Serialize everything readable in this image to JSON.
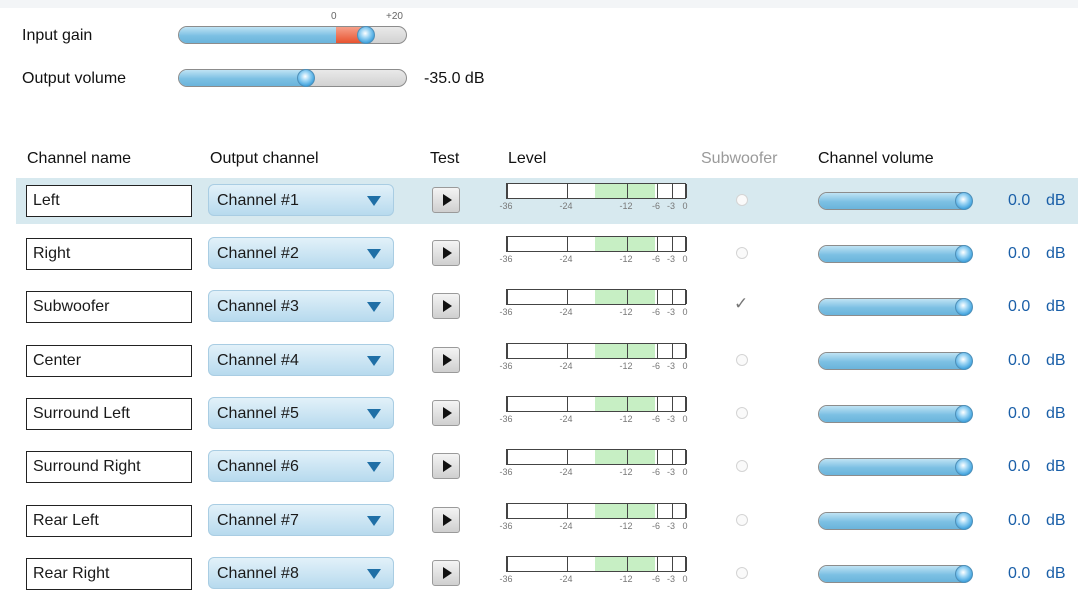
{
  "input_gain": {
    "label": "Input gain",
    "scale_min_label": "0",
    "scale_max_label": "+20",
    "level": 0.82
  },
  "output_volume": {
    "label": "Output volume",
    "value_text": "-35.0 dB",
    "level": 0.56
  },
  "columns": {
    "channel_name": "Channel name",
    "output_channel": "Output channel",
    "test": "Test",
    "level": "Level",
    "subwoofer": "Subwoofer",
    "channel_volume": "Channel volume"
  },
  "meter_labels": [
    "-36",
    "-24",
    "-12",
    "-6",
    "-3",
    "0"
  ],
  "channels": [
    {
      "name": "Left",
      "output": "Channel #1",
      "subwoofer": false,
      "volume": "0.0",
      "unit": "dB",
      "selected": true
    },
    {
      "name": "Right",
      "output": "Channel #2",
      "subwoofer": false,
      "volume": "0.0",
      "unit": "dB",
      "selected": false
    },
    {
      "name": "Subwoofer",
      "output": "Channel #3",
      "subwoofer": true,
      "volume": "0.0",
      "unit": "dB",
      "selected": false
    },
    {
      "name": "Center",
      "output": "Channel #4",
      "subwoofer": false,
      "volume": "0.0",
      "unit": "dB",
      "selected": false
    },
    {
      "name": "Surround Left",
      "output": "Channel #5",
      "subwoofer": false,
      "volume": "0.0",
      "unit": "dB",
      "selected": false
    },
    {
      "name": "Surround Right",
      "output": "Channel #6",
      "subwoofer": false,
      "volume": "0.0",
      "unit": "dB",
      "selected": false
    },
    {
      "name": "Rear Left",
      "output": "Channel #7",
      "subwoofer": false,
      "volume": "0.0",
      "unit": "dB",
      "selected": false
    },
    {
      "name": "Rear Right",
      "output": "Channel #8",
      "subwoofer": false,
      "volume": "0.0",
      "unit": "dB",
      "selected": false
    }
  ],
  "icons": {
    "play": "play-icon",
    "dropdown": "chevron-down-icon",
    "checkmark": "checkmark-icon"
  },
  "colors": {
    "accent_blue": "#3a9fdc",
    "value_text": "#1a5fa8",
    "selected_row": "#d7e9ef",
    "gain_red": "#e8532f",
    "meter_green": "#c7efc4"
  }
}
